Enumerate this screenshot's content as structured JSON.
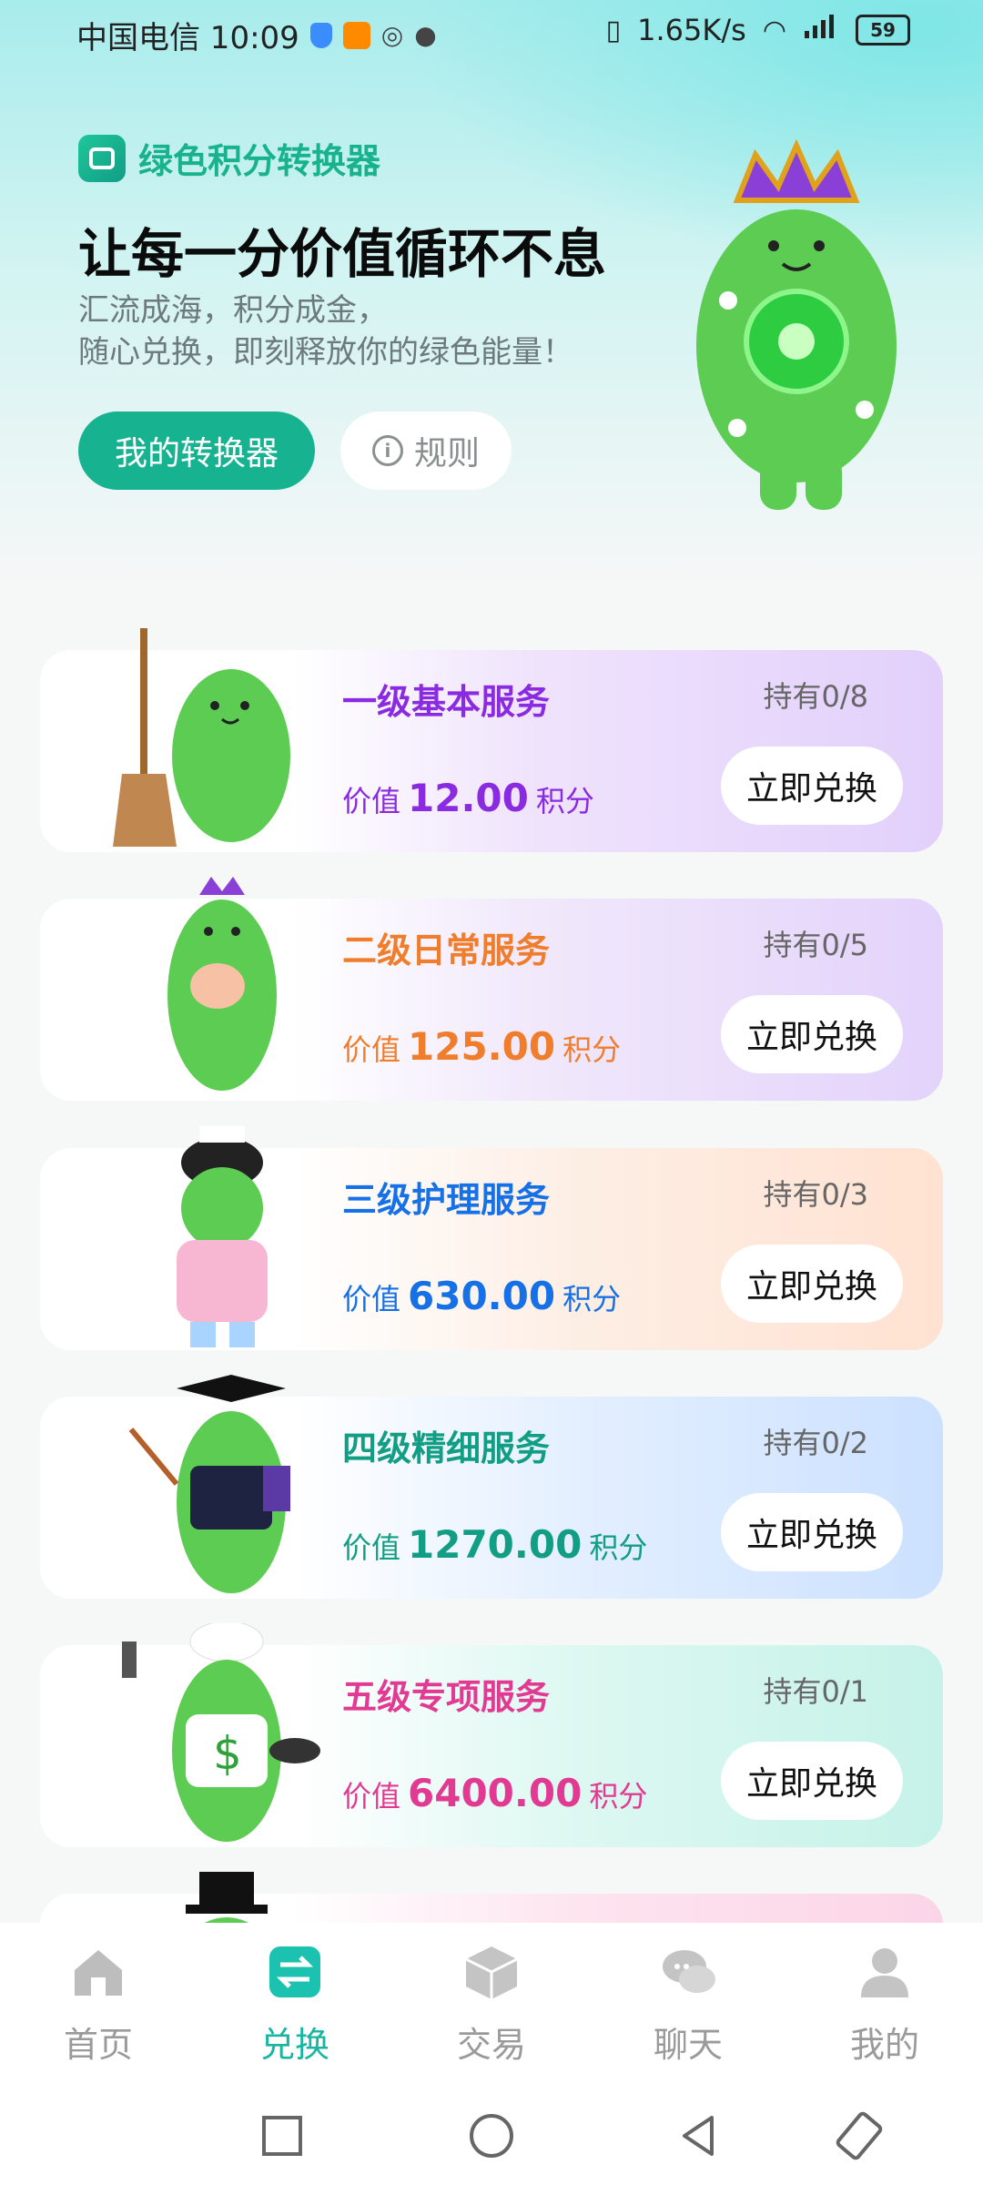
{
  "status_bar": {
    "carrier_time": "中国电信 10:09",
    "net_speed": "1.65K/s",
    "battery": "59"
  },
  "hero": {
    "brand": "绿色积分转换器",
    "headline": "让每一分价值循环不息",
    "subtitle_line1": "汇流成海，积分成金，",
    "subtitle_line2": "随心兑换，即刻释放你的绿色能量！",
    "my_converter_button": "我的转换器",
    "rules_button": "规则"
  },
  "cards": [
    {
      "title": "一级基本服务",
      "hold": "持有0/8",
      "value_prefix": "价值",
      "value": "12.00",
      "value_suffix": "积分",
      "button": "立即兑换",
      "color": "#8a2be2"
    },
    {
      "title": "二级日常服务",
      "hold": "持有0/5",
      "value_prefix": "价值",
      "value": "125.00",
      "value_suffix": "积分",
      "button": "立即兑换",
      "color": "#f07d2c"
    },
    {
      "title": "三级护理服务",
      "hold": "持有0/3",
      "value_prefix": "价值",
      "value": "630.00",
      "value_suffix": "积分",
      "button": "立即兑换",
      "color": "#1670e6"
    },
    {
      "title": "四级精细服务",
      "hold": "持有0/2",
      "value_prefix": "价值",
      "value": "1270.00",
      "value_suffix": "积分",
      "button": "立即兑换",
      "color": "#129e84"
    },
    {
      "title": "五级专项服务",
      "hold": "持有0/1",
      "value_prefix": "价值",
      "value": "6400.00",
      "value_suffix": "积分",
      "button": "立即兑换",
      "color": "#e23a93"
    }
  ],
  "nav": {
    "home": "首页",
    "exchange": "兑换",
    "trade": "交易",
    "chat": "聊天",
    "mine": "我的"
  },
  "colors": {
    "accent": "#18b6a0",
    "primary_button": "#17b290",
    "inactive": "#9a9a9a"
  }
}
